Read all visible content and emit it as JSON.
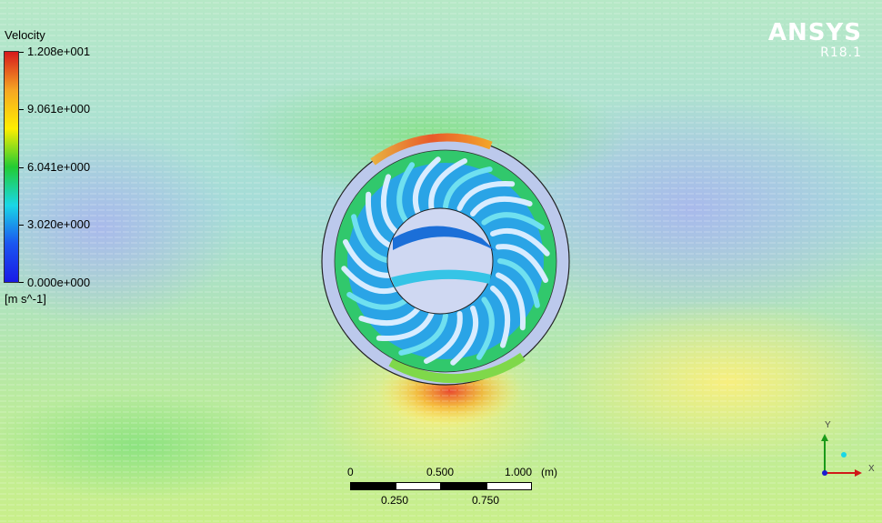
{
  "legend": {
    "title": "Velocity",
    "ticks": [
      "1.208e+001",
      "9.061e+000",
      "6.041e+000",
      "3.020e+000",
      "0.000e+000"
    ],
    "unit": "[m s^-1]",
    "colors": [
      "#d7191c",
      "#f5a623",
      "#ffee00",
      "#22cc33",
      "#19d7e6",
      "#1a56f0",
      "#1a1ae6"
    ]
  },
  "brand": {
    "name": "ANSYS",
    "version": "R18.1"
  },
  "scale_bar": {
    "top_labels": [
      "0",
      "0.500",
      "1.000"
    ],
    "unit": "(m)",
    "bottom_labels": [
      "0.250",
      "0.750"
    ]
  },
  "triad": {
    "y_label": "Y",
    "x_label": "X"
  },
  "colors": {
    "background": "#9fe0c8",
    "inlet": "#b0c6ee",
    "impeller": "#2a8fe0"
  }
}
